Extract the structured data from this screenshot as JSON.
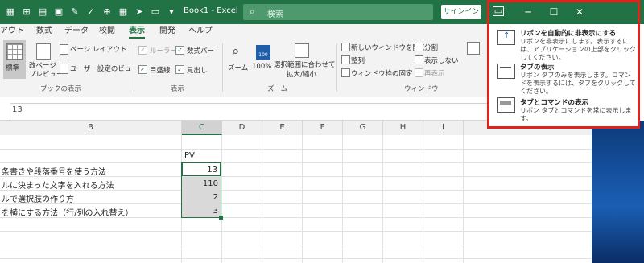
{
  "title_bar": {
    "document_title": "Book1  -  Excel",
    "search_placeholder": "検索",
    "signin_label": "サインイン"
  },
  "menu": {
    "tabs": [
      "アウト",
      "数式",
      "データ",
      "校閲",
      "表示",
      "開発",
      "ヘルプ"
    ],
    "active_tab": "表示"
  },
  "ribbon": {
    "workbook_views": {
      "normal": "標準",
      "page_break_line1": "改ページ",
      "page_break_line2": "プレビュー",
      "page_layout": "ページ レイアウト",
      "custom_views": "ユーザー設定のビュー",
      "group_label": "ブックの表示"
    },
    "show": {
      "ruler": "ルーラー",
      "formula_bar": "数式バー",
      "gridlines": "目盛線",
      "headings": "見出し",
      "group_label": "表示"
    },
    "zoom": {
      "zoom": "ズーム",
      "hundred": "100%",
      "hundred_icon": "100",
      "zoom_to_selection_line1": "選択範囲に合わせて",
      "zoom_to_selection_line2": "拡大/縮小",
      "group_label": "ズーム"
    },
    "window": {
      "new_window": "新しいウィンドウを開く",
      "arrange": "整列",
      "freeze": "ウィンドウ枠の固定",
      "split": "分割",
      "hide": "表示しない",
      "unhide": "再表示",
      "group_label": "ウィンドウ"
    }
  },
  "formula_bar": {
    "value": "13"
  },
  "columns": [
    "B",
    "C",
    "D",
    "E",
    "F",
    "G",
    "H",
    "I"
  ],
  "selected_column": "C",
  "sheet": {
    "header_c": "PV",
    "rows": [
      {
        "b": "条書きや段落番号を使う方法",
        "c": "13"
      },
      {
        "b": "ルに決まった文字を入れる方法",
        "c": "110"
      },
      {
        "b": "ルで選択肢の作り方",
        "c": "2"
      },
      {
        "b": "を横にする方法（行/列の入れ替え）",
        "c": "3"
      }
    ]
  },
  "ribbon_options_popup": {
    "options": [
      {
        "icon": "auto-hide-ribbon-icon",
        "title": "リボンを自動的に非表示にする",
        "desc": "リボンを非表示にします。表示するには、アプリケーションの上部をクリックしてください。"
      },
      {
        "icon": "show-tabs-icon",
        "title": "タブの表示",
        "desc": "リボン タブのみを表示します。コマンドを表示するには、タブをクリックしてください。"
      },
      {
        "icon": "show-tabs-and-commands-icon",
        "title": "タブとコマンドの表示",
        "desc": "リボン タブとコマンドを常に表示します。"
      }
    ],
    "highlight_color": "#e2231a"
  },
  "colors": {
    "excel_green": "#217346"
  }
}
